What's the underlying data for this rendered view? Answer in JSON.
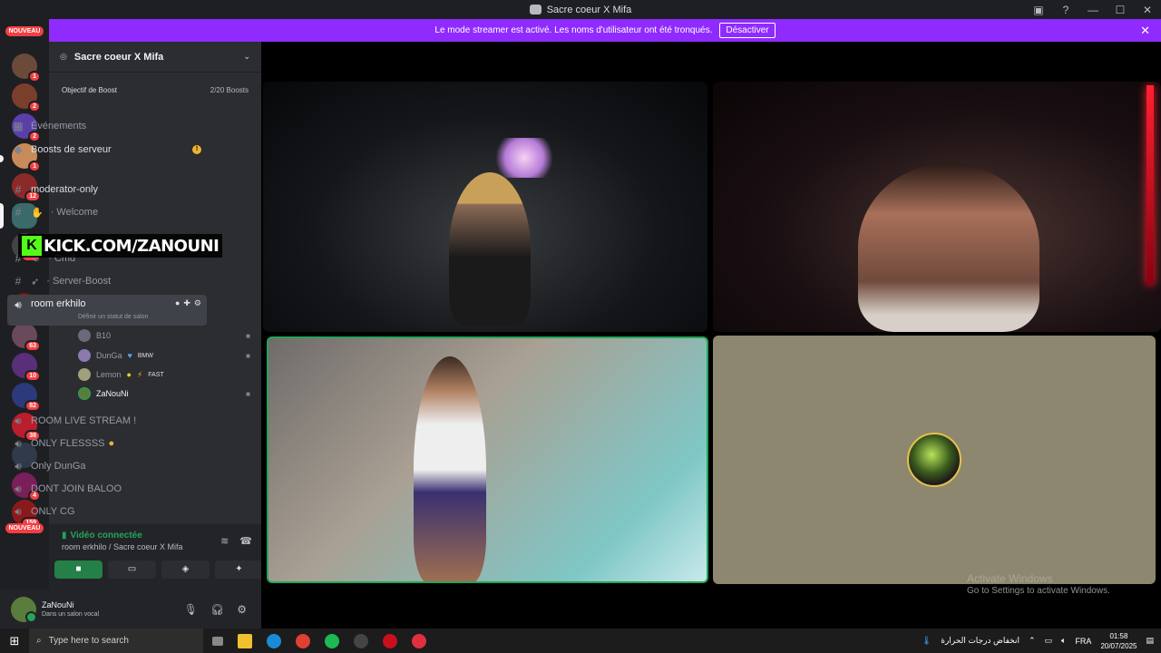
{
  "window": {
    "title": "Sacre coeur X Mifa"
  },
  "banner": {
    "text": "Le mode streamer est activé. Les noms d'utilisateur ont été tronqués.",
    "disable_label": "Désactiver",
    "color": "#8f2bff"
  },
  "rail": {
    "nouveau_label": "NOUVEAU",
    "badges": [
      "1",
      "2",
      "2",
      "1",
      "12",
      "359",
      "63",
      "10",
      "82",
      "38",
      "4",
      "159"
    ]
  },
  "server": {
    "name": "Sacre coeur X Mifa",
    "boost_goal_label": "Objectif de Boost",
    "boost_count": "2/20 Boosts"
  },
  "channels": {
    "events": "Événements",
    "server_boosts": "Boosts de serveur",
    "moderator_only": "moderator-only",
    "welcome": "· Welcome",
    "cmd": "· Cmd",
    "server_boost": "· Server-Boost",
    "room_erkhilo": "room erkhilo",
    "set_status": "Définir un statut de salon",
    "room_live_stream": "ROOM LIVE STREAM !",
    "only_flessss": "ONLY FLESSSS",
    "only_dunga": "Only DunGa",
    "dont_join_baloo": "DONT JOIN BALOO",
    "only_cg": "ONLY CG"
  },
  "voice_users": [
    {
      "name": "B10",
      "tag": ""
    },
    {
      "name": "DunGa",
      "tag": "BMW"
    },
    {
      "name": "Lemon",
      "tag": "FAST"
    },
    {
      "name": "ZaNouNi",
      "tag": ""
    }
  ],
  "overlay": {
    "kick_text": "KICK.COM/ZANOUNI",
    "kick_color": "#53fc18"
  },
  "voice_panel": {
    "status": "Vidéo connectée",
    "location": "room erkhilo / Sacre coeur X Mifa"
  },
  "user": {
    "name": "ZaNouNi",
    "status": "Dans un salon vocal"
  },
  "watermark": {
    "title": "Activate Windows",
    "subtitle": "Go to Settings to activate Windows."
  },
  "taskbar": {
    "search_placeholder": "Type here to search",
    "weather": "انخفاض درجات الحرارة",
    "lang": "FRA",
    "time": "01:58",
    "date": "20/07/2025"
  }
}
